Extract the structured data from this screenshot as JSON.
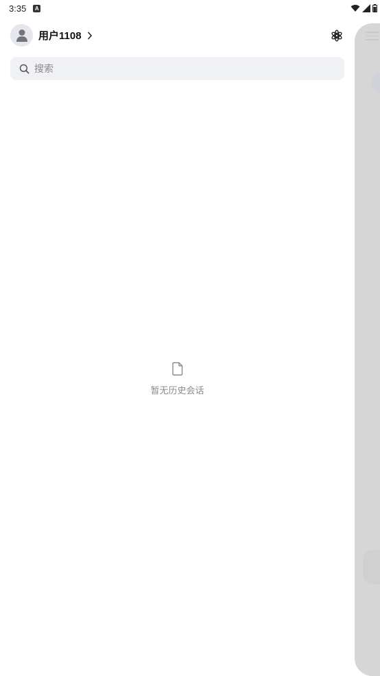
{
  "status_bar": {
    "time": "3:35",
    "notification_icon": "app-notification-icon",
    "indicators": [
      "wifi-icon",
      "signal-icon",
      "battery-icon"
    ]
  },
  "drawer": {
    "user": {
      "name": "用户1108",
      "avatar_icon": "person-icon",
      "chevron_icon": "chevron-right-icon"
    },
    "settings_icon": "settings-icon",
    "search": {
      "placeholder": "搜索",
      "value": "",
      "icon": "search-icon"
    },
    "empty_state": {
      "icon": "document-icon",
      "message": "暂无历史会话"
    }
  },
  "colors": {
    "background": "#ffffff",
    "search_bg": "#f0f1f5",
    "avatar_bg": "#e6e7ec",
    "peek_panel": "#d6d6d6",
    "muted_text": "#888a90"
  }
}
